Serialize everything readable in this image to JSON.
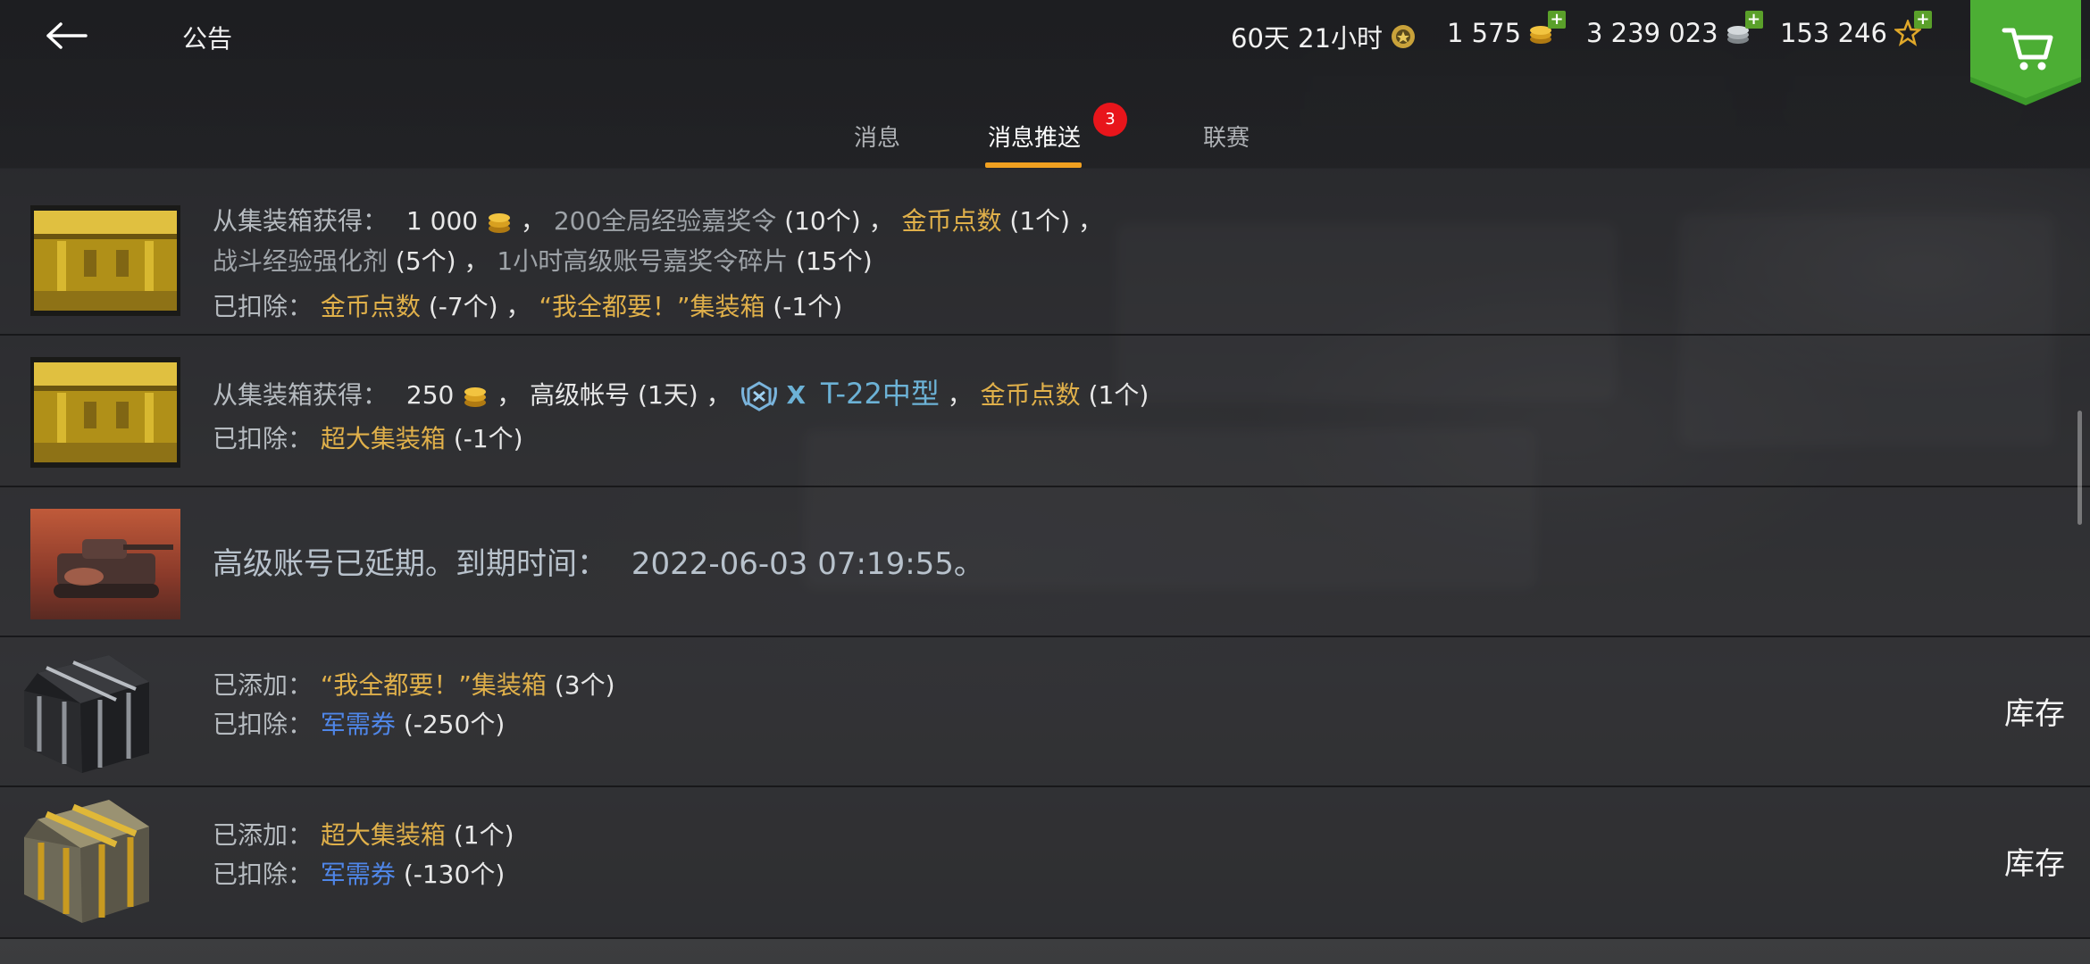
{
  "header": {
    "title": "公告",
    "premium_time": "60天 21小时",
    "gold": "1 575",
    "credits": "3 239 023",
    "free_xp": "153 246"
  },
  "tabs": [
    {
      "label": "消息"
    },
    {
      "label": "消息推送",
      "badge": "3"
    },
    {
      "label": "联赛"
    }
  ],
  "rows": [
    {
      "line1": {
        "label": "从集装箱获得：",
        "gold_amount": "1 000",
        "sep1": "，",
        "item1": "200全局经验嘉奖令",
        "qty1": "(10个)",
        "sep2": "，",
        "item2": "金币点数",
        "qty2": "(1个)",
        "sep3": "，"
      },
      "line2": {
        "item3": "战斗经验强化剂",
        "qty3": "(5个)",
        "sep": "，",
        "item4": "1小时高级账号嘉奖令碎片",
        "qty4": "(15个)"
      },
      "line3": {
        "label": "已扣除：",
        "item1": "金币点数",
        "qty1": "(-7个)",
        "sep": "，",
        "item2": "“我全都要！”集装箱",
        "qty2": "(-1个)"
      }
    },
    {
      "line1": {
        "label": "从集装箱获得：",
        "gold_amount": "250",
        "sep1": "，",
        "item1": "高级帐号",
        "qty1": "(1天)",
        "sep2": "，",
        "tier": "X",
        "tank": "T-22中型",
        "sep3": "，",
        "item2": "金币点数",
        "qty2": "(1个)"
      },
      "line2": {
        "label": "已扣除：",
        "item1": "超大集装箱",
        "qty1": "(-1个)"
      }
    },
    {
      "message_prefix": "高级账号已延期。到期时间：",
      "date": "2022-06-03 07:19:55。"
    },
    {
      "line1": {
        "label": "已添加：",
        "item": "“我全都要！”集装箱",
        "qty": "(3个)"
      },
      "line2": {
        "label": "已扣除：",
        "item": "军需券",
        "qty": "(-250个)"
      },
      "action": "库存"
    },
    {
      "line1": {
        "label": "已添加：",
        "item": "超大集装箱",
        "qty": "(1个)"
      },
      "line2": {
        "label": "已扣除：",
        "item": "军需券",
        "qty": "(-130个)"
      },
      "action": "库存"
    }
  ],
  "colors": {
    "accent_tab": "#f0a020",
    "badge": "#e8151b",
    "gold_text": "#e0b04a",
    "blue_text": "#4f86e8",
    "cart_green": "#3c9a2a"
  },
  "icons": [
    "back-arrow-icon",
    "premium-laurel-icon",
    "gold-coin-icon",
    "silver-coin-icon",
    "star-icon",
    "plus-icon",
    "cart-icon",
    "tier-x-icon"
  ]
}
